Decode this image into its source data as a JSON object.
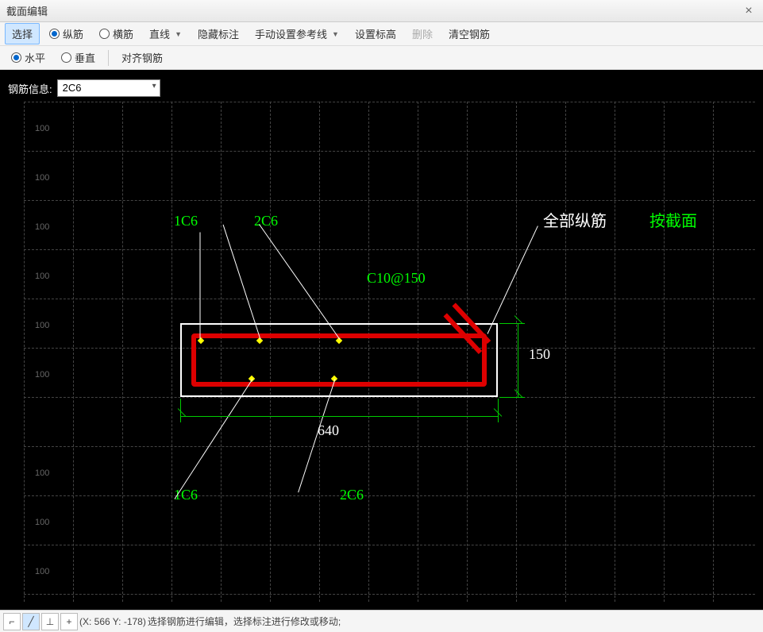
{
  "window": {
    "title": "截面编辑"
  },
  "toolbar1": {
    "select": "选择",
    "longitudinal": "纵筋",
    "transverse": "横筋",
    "line": "直线",
    "hide_anno": "隐藏标注",
    "manual_ref": "手动设置参考线",
    "set_elev": "设置标高",
    "delete": "删除",
    "clear": "清空钢筋"
  },
  "toolbar2": {
    "horizontal": "水平",
    "vertical": "垂直",
    "align": "对齐钢筋"
  },
  "rebar_info": {
    "label": "钢筋信息:",
    "value": "2C6"
  },
  "canvas": {
    "grid_label": "100",
    "annotations": {
      "top_1c6": "1C6",
      "top_2c6": "2C6",
      "c10_150": "C10@150",
      "bottom_1c6": "1C6",
      "bottom_2c6": "2C6",
      "all_long": "全部纵筋",
      "by_section": "按截面"
    },
    "dimensions": {
      "width": "640",
      "height": "150"
    }
  },
  "status": {
    "coords": "(X: 566 Y: -178)",
    "hint": "选择钢筋进行编辑，选择标注进行修改或移动;"
  }
}
